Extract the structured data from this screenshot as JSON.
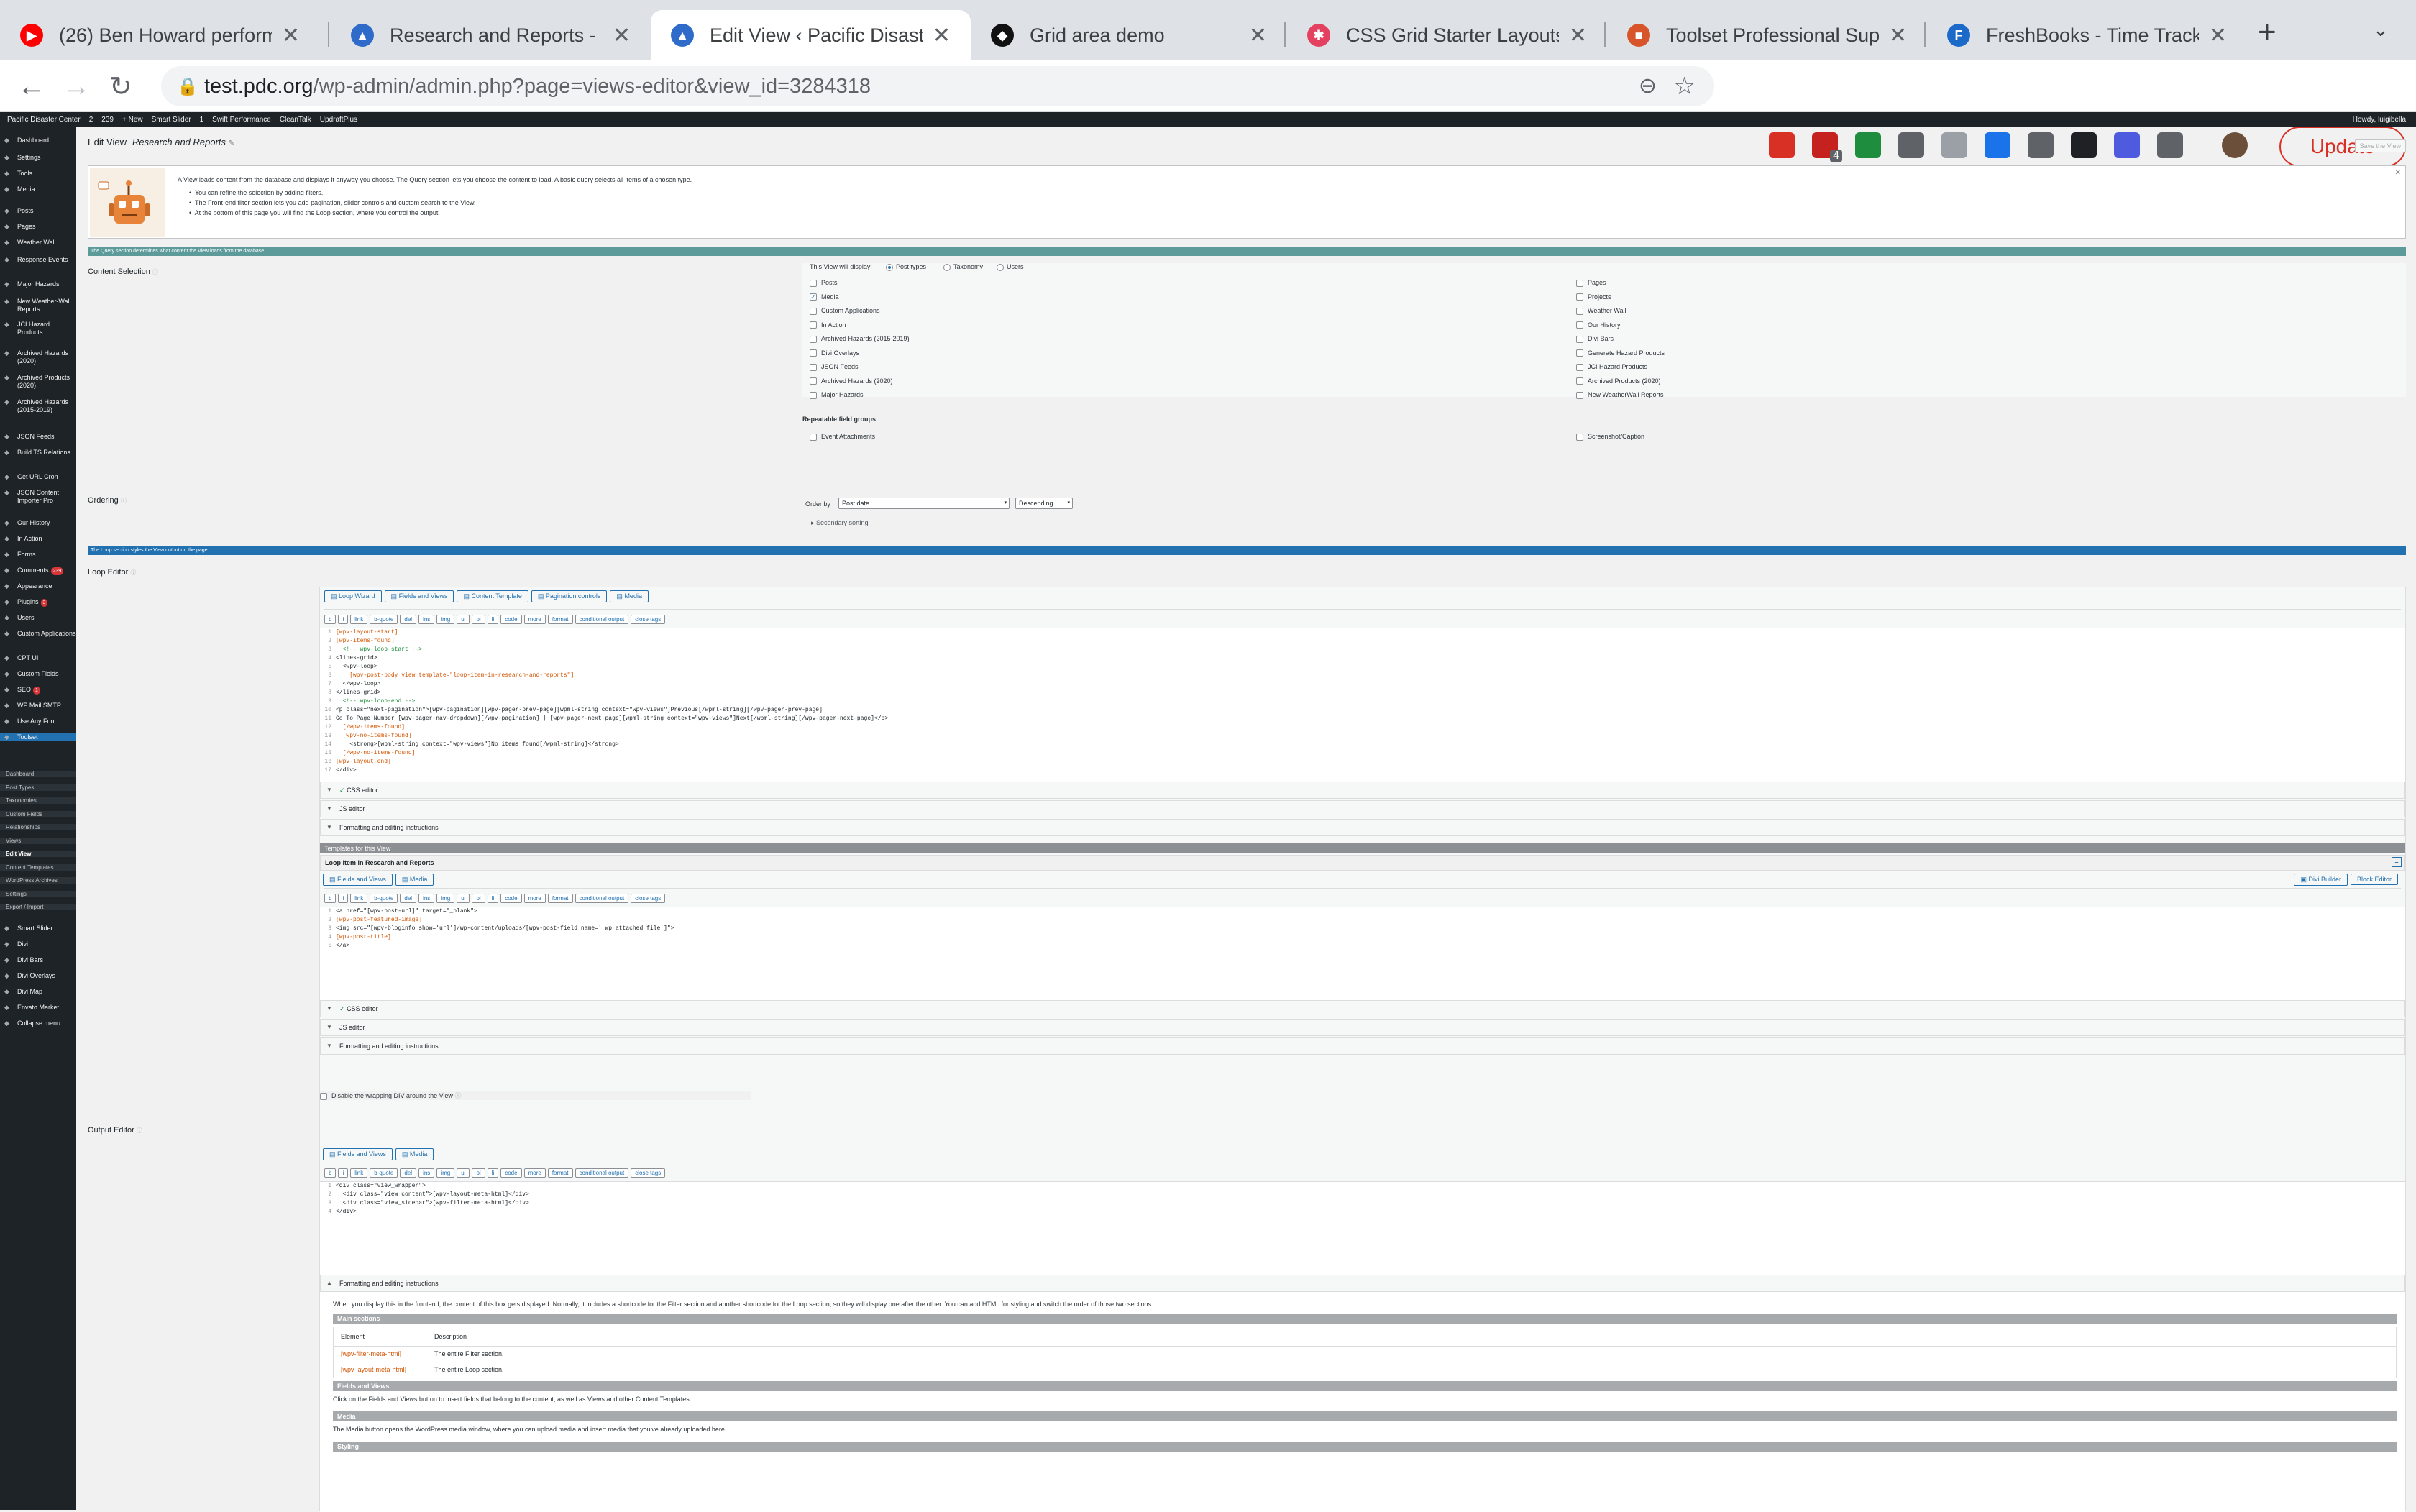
{
  "browser": {
    "tabs": [
      {
        "title": "(26) Ben Howard performing",
        "icon": "youtube-icon",
        "color": "#ff0000",
        "glyph": "▶"
      },
      {
        "title": "Research and Reports - Pac",
        "icon": "site-icon",
        "color": "#2f6bc8",
        "glyph": "▲"
      },
      {
        "title": "Edit View ‹ Pacific Disaster",
        "icon": "site-icon",
        "color": "#2f6bc8",
        "glyph": "▲"
      },
      {
        "title": "Grid area demo",
        "icon": "codepen-icon",
        "color": "#111111",
        "glyph": "◆"
      },
      {
        "title": "CSS Grid Starter Layouts | C",
        "icon": "asterisk-icon",
        "color": "#e4405f",
        "glyph": "✱"
      },
      {
        "title": "Toolset Professional Suppor",
        "icon": "toolset-icon",
        "color": "#d8542b",
        "glyph": "■"
      },
      {
        "title": "FreshBooks - Time Tracking",
        "icon": "freshbooks-icon",
        "color": "#1b6ac9",
        "glyph": "F"
      }
    ],
    "url_host": "test.pdc.org",
    "url_path": "/wp-admin/admin.php?page=views-editor&view_id=3284318",
    "update_label": "Update",
    "extension_badge": "4",
    "extensions_colors": [
      "#d93025",
      "#c5221f",
      "#1e8e3e",
      "#5f6368",
      "#9aa0a6",
      "#1a73e8",
      "#5f6368",
      "#202124",
      "#4e5bde",
      "#5f6368"
    ]
  },
  "adminbar": {
    "items": [
      "Pacific Disaster Center",
      "2",
      "239",
      "+ New",
      "Smart Slider",
      "1",
      "Swift Performance",
      "CleanTalk",
      "UpdraftPlus"
    ],
    "howdy": "Howdy, luigibella"
  },
  "sidebar": {
    "items": [
      {
        "label": "Dashboard"
      },
      {
        "label": "Settings"
      },
      {
        "label": "Tools"
      },
      {
        "label": "Media"
      },
      {
        "label": "Posts"
      },
      {
        "label": "Pages"
      },
      {
        "label": "Weather Wall"
      },
      {
        "label": "Response Events"
      },
      {
        "label": "Major Hazards"
      },
      {
        "label": "New Weather-Wall Reports"
      },
      {
        "label": "JCI Hazard Products"
      },
      {
        "label": "Archived Hazards (2020)"
      },
      {
        "label": "Archived Products (2020)"
      },
      {
        "label": "Archived Hazards (2015-2019)"
      },
      {
        "label": "JSON Feeds"
      },
      {
        "label": "Build TS Relations"
      },
      {
        "label": "Get URL Cron"
      },
      {
        "label": "JSON Content Importer Pro"
      },
      {
        "label": "Our History"
      },
      {
        "label": "In Action"
      },
      {
        "label": "Forms"
      },
      {
        "label": "Comments",
        "badge": "239"
      },
      {
        "label": "Appearance"
      },
      {
        "label": "Plugins",
        "badge": "3"
      },
      {
        "label": "Users"
      },
      {
        "label": "Custom Applications"
      },
      {
        "label": "CPT UI"
      },
      {
        "label": "Custom Fields"
      },
      {
        "label": "SEO",
        "badge": "1"
      },
      {
        "label": "WP Mail SMTP"
      },
      {
        "label": "Use Any Font"
      },
      {
        "label": "Toolset"
      }
    ],
    "sub": [
      "Dashboard",
      "Post Types",
      "Taxonomies",
      "Custom Fields",
      "Relationships",
      "Views",
      "Edit View",
      "Content Templates",
      "WordPress Archives",
      "Settings",
      "Export / Import"
    ],
    "bottom": [
      "Smart Slider",
      "Divi",
      "Divi Bars",
      "Divi Overlays",
      "Divi Map",
      "Envato Market",
      "Collapse menu"
    ]
  },
  "page": {
    "title": "Edit View",
    "view_name": "Research and Reports",
    "save_label": "Save the View",
    "intro": [
      "A View loads content from the database and displays it anyway you choose. The Query section lets you choose the content to load. A basic query selects all items of a chosen type.",
      "You can refine the selection by adding filters.",
      "The Front-end filter section lets you add pagination, slider controls and custom search to the View.",
      "At the bottom of this page you will find the Loop section, where you control the output."
    ],
    "query_bar": "The Query section determines what content the View loads from the database",
    "loop_bar": "The Loop section styles the View output on the page.",
    "content_selection_label": "Content Selection",
    "display_label": "This View will display:",
    "display_options": [
      {
        "label": "Post types",
        "on": true
      },
      {
        "label": "Taxonomy",
        "on": false
      },
      {
        "label": "Users",
        "on": false
      }
    ],
    "post_types_left": [
      {
        "label": "Posts",
        "on": false
      },
      {
        "label": "Media",
        "on": true
      },
      {
        "label": "Custom Applications",
        "on": false
      },
      {
        "label": "In Action",
        "on": false
      },
      {
        "label": "Archived Hazards (2015-2019)",
        "on": false
      },
      {
        "label": "Divi Overlays",
        "on": false
      },
      {
        "label": "JSON Feeds",
        "on": false
      },
      {
        "label": "Archived Hazards (2020)",
        "on": false
      },
      {
        "label": "Major Hazards",
        "on": false
      }
    ],
    "post_types_right": [
      {
        "label": "Pages",
        "on": false
      },
      {
        "label": "Projects",
        "on": false
      },
      {
        "label": "Weather Wall",
        "on": false
      },
      {
        "label": "Our History",
        "on": false
      },
      {
        "label": "Divi Bars",
        "on": false
      },
      {
        "label": "Generate Hazard Products",
        "on": false
      },
      {
        "label": "JCI Hazard Products",
        "on": false
      },
      {
        "label": "Archived Products (2020)",
        "on": false
      },
      {
        "label": "New WeatherWall Reports",
        "on": false
      }
    ],
    "repeatable_label": "Repeatable field groups",
    "repeatable": [
      "Event Attachments",
      "Screenshot/Caption"
    ],
    "ordering_label": "Ordering",
    "order_by_label": "Order by",
    "order_by_value": "Post date",
    "order_dir_value": "Descending",
    "secondary_sorting": "Secondary sorting",
    "loop_editor_label": "Loop Editor",
    "loop_buttons": [
      "Loop Wizard",
      "Fields and Views",
      "Content Template",
      "Pagination controls",
      "Media"
    ],
    "quicktags": [
      "b",
      "i",
      "link",
      "b-quote",
      "del",
      "ins",
      "img",
      "ul",
      "ol",
      "li",
      "code",
      "more",
      "format",
      "conditional output",
      "close tags"
    ],
    "loop_code": [
      "[wpv-layout-start]",
      "[wpv-items-found]",
      "  <!-- wpv-loop-start -->",
      "<lines-grid>",
      "  <wpv-loop>",
      "    [wpv-post-body view_template=\"loop-item-in-research-and-reports\"]",
      "  </wpv-loop>",
      "</lines-grid>",
      "  <!-- wpv-loop-end -->",
      "<p class=\"next-pagination\">[wpv-pagination][wpv-pager-prev-page][wpml-string context=\"wpv-views\"]Previous[/wpml-string][/wpv-pager-prev-page]",
      "Go To Page Number [wpv-pager-nav-dropdown][/wpv-pagination] | [wpv-pager-next-page][wpml-string context=\"wpv-views\"]Next[/wpml-string][/wpv-pager-next-page]</p>",
      "  [/wpv-items-found]",
      "  [wpv-no-items-found]",
      "    <strong>[wpml-string context=\"wpv-views\"]No items found[/wpml-string]</strong>",
      "  [/wpv-no-items-found]",
      "[wpv-layout-end]",
      "</div>"
    ],
    "css_editor": "CSS editor",
    "js_editor": "JS editor",
    "formatting": "Formatting and editing instructions",
    "templates_header": "Templates for this View",
    "template_title": "Loop item in Research and Reports",
    "template_buttons": [
      "Fields and Views",
      "Media"
    ],
    "divi_builder": "Divi Builder",
    "block_editor": "Block Editor",
    "template_code": [
      "<a href=\"[wpv-post-url]\" target=\"_blank\">",
      "[wpv-post-featured-image]",
      "<img src=\"[wpv-bloginfo show='url']/wp-content/uploads/[wpv-post-field name='_wp_attached_file']\">",
      "[wpv-post-title]",
      "</a>"
    ],
    "disable_wrap": "Disable the wrapping DIV around the View",
    "output_editor_label": "Output Editor",
    "output_buttons": [
      "Fields and Views",
      "Media"
    ],
    "output_code": [
      "<div class=\"view_wrapper\">",
      "  <div class=\"view_content\">[wpv-layout-meta-html]</div>",
      "  <div class=\"view_sidebar\">[wpv-filter-meta-html]</div>",
      "</div>"
    ],
    "instructions_text": "When you display this in the frontend, the content of this box gets displayed. Normally, it includes a shortcode for the Filter section and another shortcode for the Loop section, so they will display one after the other. You can add HTML for styling and switch the order of those two sections.",
    "main_sections": "Main sections",
    "table_head": [
      "Element",
      "Description"
    ],
    "table_rows": [
      [
        "[wpv-filter-meta-html]",
        "The entire Filter section."
      ],
      [
        "[wpv-layout-meta-html]",
        "The entire Loop section."
      ]
    ],
    "fields_views_head": "Fields and Views",
    "fields_views_text": "Click on the Fields and Views button to insert fields that belong to the content, as well as Views and other Content Templates.",
    "media_head": "Media",
    "media_text": "The Media button opens the WordPress media window, where you can upload media and insert media that you've already uploaded here.",
    "styling_head": "Styling"
  }
}
